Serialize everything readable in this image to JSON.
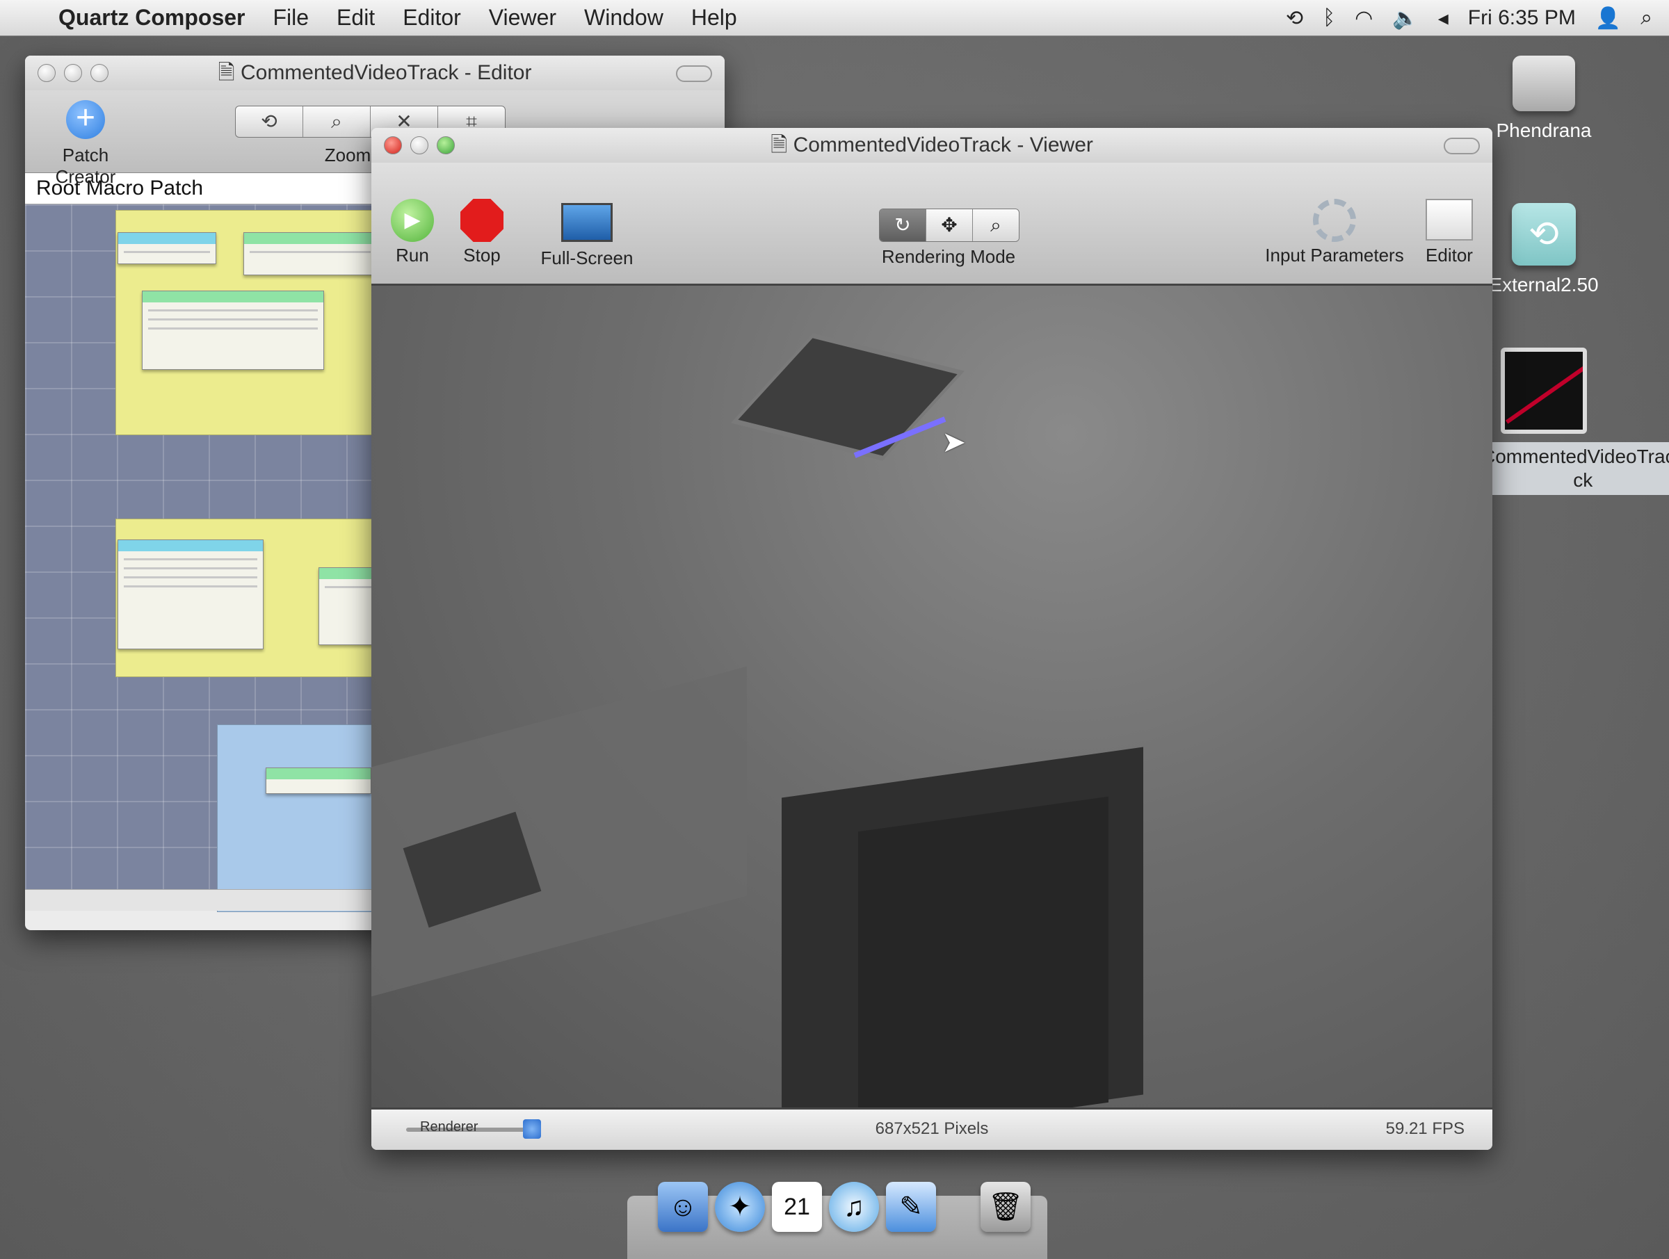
{
  "menubar": {
    "apple_glyph": "",
    "app_name": "Quartz Composer",
    "menus": [
      "File",
      "Edit",
      "Editor",
      "Viewer",
      "Window",
      "Help"
    ],
    "clock": "Fri 6:35 PM"
  },
  "desktop": {
    "icons": [
      {
        "label": "Phendrana"
      },
      {
        "label": "External2.50"
      },
      {
        "label": "CommentedVideoTrack",
        "label_line2": "ck"
      }
    ]
  },
  "editor": {
    "title": "CommentedVideoTrack - Editor",
    "toolbar": {
      "patch_creator_label": "Patch Creator",
      "zoom_label": "Zoom"
    },
    "path": "Root Macro Patch"
  },
  "viewer": {
    "title": "CommentedVideoTrack - Viewer",
    "toolbar": {
      "run_label": "Run",
      "stop_label": "Stop",
      "fullscreen_label": "Full-Screen",
      "rendering_mode_label": "Rendering Mode",
      "input_parameters_label": "Input Parameters",
      "editor_label": "Editor"
    },
    "status": {
      "renderer_label": "Renderer",
      "frame_info": "687x521 Pixels",
      "fps": "59.21 FPS"
    }
  },
  "dock": {
    "calendar_day": "21"
  },
  "colors": {
    "close": "#d2231b",
    "zoom": "#3aa33a",
    "stop": "#e21c1c",
    "selection_blue": "#2f7fe0"
  }
}
